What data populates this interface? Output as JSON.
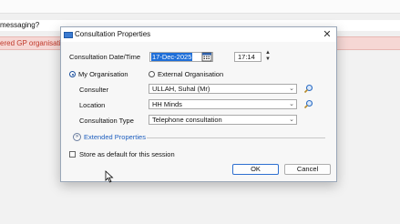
{
  "background": {
    "line1_text": "messaging?",
    "line2_text": "ered GP organisati"
  },
  "dialog": {
    "title": "Consultation Properties",
    "close_label": "✕",
    "date_time_label": "Consultation Date/Time",
    "date_value": "17-Dec-2025",
    "time_value": "17:14",
    "org_options": [
      "My Organisation",
      "External Organisation"
    ],
    "selected_org": "My Organisation",
    "consulter_label": "Consulter",
    "consulter_value": "ULLAH, Suhal (Mr)",
    "location_label": "Location",
    "location_value": "HH Minds",
    "type_label": "Consultation Type",
    "type_value": "Telephone consultation",
    "extended_label": "Extended Properties",
    "default_label": "Store as default for this session",
    "default_checked": false,
    "ok_label": "OK",
    "cancel_label": "Cancel"
  },
  "colors": {
    "accent": "#1e6ed8",
    "link": "#1f5fbf",
    "warning_bg": "#f6d7d4",
    "warning_text": "#c0392b"
  }
}
